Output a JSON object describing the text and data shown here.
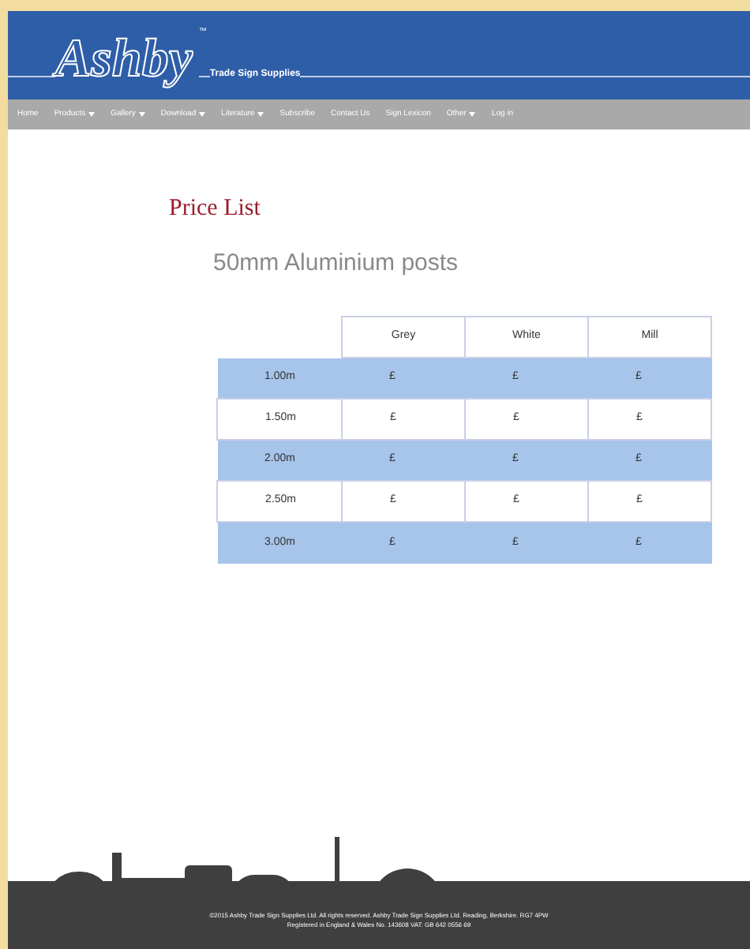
{
  "logo": {
    "name": "Ashby",
    "trademark": "™",
    "tagline": "Trade Sign Supplies"
  },
  "nav": [
    {
      "label": "Home",
      "dropdown": false
    },
    {
      "label": "Products",
      "dropdown": true
    },
    {
      "label": "Gallery",
      "dropdown": true
    },
    {
      "label": "Download",
      "dropdown": true
    },
    {
      "label": "Literature",
      "dropdown": true
    },
    {
      "label": "Subscribe",
      "dropdown": false
    },
    {
      "label": "Contact Us",
      "dropdown": false
    },
    {
      "label": "Sign Lexicon",
      "dropdown": false
    },
    {
      "label": "Other",
      "dropdown": true
    },
    {
      "label": "Log in",
      "dropdown": false
    }
  ],
  "page_title": "Price List",
  "section_title": "50mm Aluminium posts",
  "table": {
    "columns": [
      "Grey",
      "White",
      "Mill"
    ],
    "rows": [
      {
        "label": "1.00m",
        "cells": [
          "£",
          "£",
          "£"
        ],
        "shaded": true
      },
      {
        "label": "1.50m",
        "cells": [
          "£",
          "£",
          "£"
        ],
        "shaded": false
      },
      {
        "label": "2.00m",
        "cells": [
          "£",
          "£",
          "£"
        ],
        "shaded": true
      },
      {
        "label": "2.50m",
        "cells": [
          "£",
          "£",
          "£"
        ],
        "shaded": false
      },
      {
        "label": "3.00m",
        "cells": [
          "£",
          "£",
          "£"
        ],
        "shaded": true
      }
    ]
  },
  "footer": [
    "©2015 Ashby Trade Sign Supplies Ltd. All rights reserved. Ashby Trade Sign Supplies Ltd. Reading, Berkshire. RG7 4PW",
    "Registered in England & Wales No. 143608 VAT: GB 642 0556 69"
  ]
}
